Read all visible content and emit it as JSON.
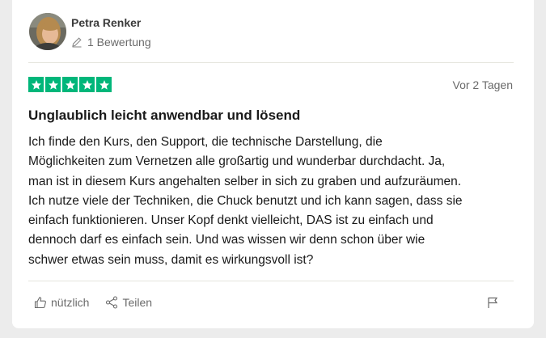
{
  "review": {
    "author": {
      "name": "Petra Renker",
      "reviews_count": "1 Bewertung",
      "avatar_icon": "user-photo"
    },
    "rating": 5,
    "rating_max": 5,
    "star_color": "#00b67a",
    "date": "Vor 2 Tagen",
    "title": "Unglaublich leicht anwendbar und lösend",
    "body_lines": [
      "Ich finde den Kurs, den Support, die technische Darstellung, die",
      "Möglichkeiten zum Vernetzen alle großartig und wunderbar durchdacht. Ja,",
      "man ist in diesem Kurs angehalten selber in sich zu graben und aufzuräumen.",
      "Ich nutze viele der Techniken, die Chuck benutzt und ich kann sagen, dass sie",
      "einfach funktionieren. Unser Kopf denkt vielleicht, DAS ist zu einfach und",
      "dennoch darf es einfach sein. Und was wissen wir denn schon über wie",
      "schwer etwas sein muss, damit es wirkungsvoll ist?"
    ]
  },
  "actions": {
    "useful_label": "nützlich",
    "useful_icon": "thumbs-up-icon",
    "share_label": "Teilen",
    "share_icon": "share-icon",
    "flag_icon": "flag-icon"
  }
}
